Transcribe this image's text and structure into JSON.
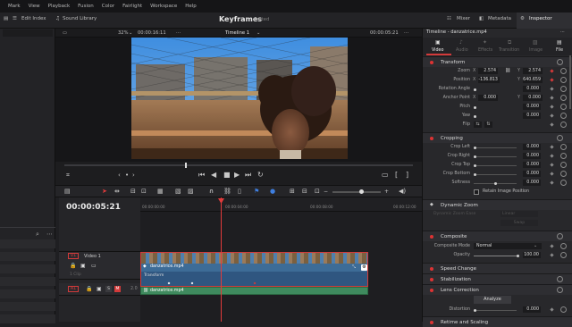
{
  "menubar": {
    "items": [
      "Mark",
      "View",
      "Playback",
      "Fusion",
      "Color",
      "Fairlight",
      "Workspace",
      "Help"
    ]
  },
  "toolbar": {
    "left_items": [
      "Edit Index",
      "Sound Library"
    ],
    "title": "Keyframes",
    "subtitle": "Edited",
    "mixer": "Mixer",
    "metadata": "Metadata",
    "inspector": "Inspector"
  },
  "viewerbar": {
    "zoom": "32%",
    "timecode": "00:00:16:11",
    "timeline_name": "Timeline 1",
    "timecode_right": "00:00:05:21"
  },
  "timeline": {
    "current_timecode": "00:00:05:21",
    "ruler_labels": [
      "00:00:00:00",
      "00:00:04:00",
      "00:00:08:00",
      "00:00:12:00",
      "00:00:16:00"
    ],
    "tracks": {
      "v1_badge": "V1",
      "v1_name": "Video 1",
      "clip_count": "1 Clip",
      "a1_badge": "A1",
      "a1_num": "2.0",
      "a1_m": "M"
    },
    "clips": {
      "video_clip": "danzatrice.mp4",
      "transform_label": "Transform",
      "audio_clip": "danzatrice.mp4"
    }
  },
  "inspector": {
    "header_title": "Timeline - danzatrice.mp4",
    "tabs": [
      "Video",
      "Audio",
      "Effects",
      "Transition",
      "Image",
      "File"
    ],
    "transform": {
      "title": "Transform",
      "zoom_label": "Zoom",
      "zoom_x_axis": "X",
      "zoom_x": "2.574",
      "zoom_y_axis": "Y",
      "zoom_y": "2.574",
      "position_label": "Position",
      "pos_x_axis": "X",
      "pos_x": "-136.813",
      "pos_y_axis": "Y",
      "pos_y": "640.659",
      "rotation_label": "Rotation Angle",
      "rotation": "0.000",
      "anchor_label": "Anchor Point",
      "anchor_x_axis": "X",
      "anchor_x": "0.000",
      "anchor_y_axis": "Y",
      "anchor_y": "0.000",
      "pitch_label": "Pitch",
      "pitch": "0.000",
      "yaw_label": "Yaw",
      "yaw": "0.000",
      "flip_label": "Flip"
    },
    "cropping": {
      "title": "Cropping",
      "crop_left_label": "Crop Left",
      "crop_left": "0.000",
      "crop_right_label": "Crop Right",
      "crop_right": "0.000",
      "crop_top_label": "Crop Top",
      "crop_top": "0.000",
      "crop_bottom_label": "Crop Bottom",
      "crop_bottom": "0.000",
      "softness_label": "Softness",
      "softness": "0.000",
      "retain_label": "Retain Image Position"
    },
    "dynamic_zoom": {
      "title": "Dynamic Zoom",
      "ease_label": "Dynamic Zoom Ease",
      "ease_value": "Linear",
      "swap": "Swap"
    },
    "composite": {
      "title": "Composite",
      "mode_label": "Composite Mode",
      "mode_value": "Normal",
      "opacity_label": "Opacity",
      "opacity": "100.00"
    },
    "speed_change": {
      "title": "Speed Change"
    },
    "stabilization": {
      "title": "Stabilization"
    },
    "lens_correction": {
      "title": "Lens Correction",
      "analyze": "Analyze",
      "distortion_label": "Distortion",
      "distortion": "0.000"
    },
    "retime": {
      "title": "Retime and Scaling"
    }
  },
  "colors": {
    "accent_red": "#d33a3a",
    "clip_blue": "#3d6c97",
    "audio_green": "#3f8a5e",
    "playhead": "#e23b3b"
  }
}
